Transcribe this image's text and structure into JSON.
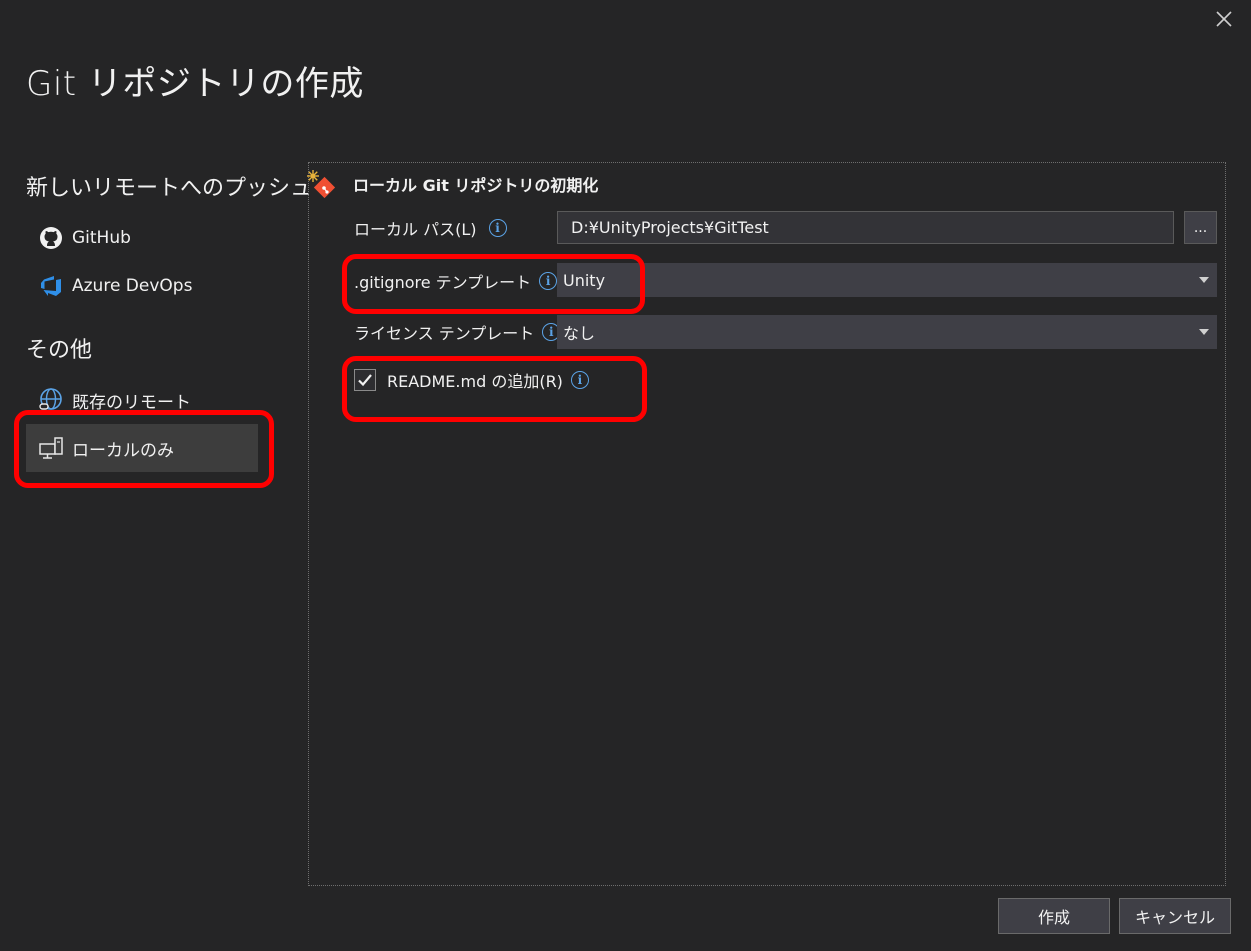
{
  "dialog": {
    "title": "Git リポジトリの作成"
  },
  "sidebar": {
    "push_section": "新しいリモートへのプッシュ",
    "other_section": "その他",
    "items": [
      {
        "label": "GitHub",
        "icon": "github-icon"
      },
      {
        "label": "Azure DevOps",
        "icon": "azure-devops-icon"
      },
      {
        "label": "既存のリモート",
        "icon": "globe-link-icon"
      },
      {
        "label": "ローカルのみ",
        "icon": "local-computer-icon",
        "selected": true
      }
    ]
  },
  "panel": {
    "header": "ローカル Git リポジトリの初期化",
    "local_path_label": "ローカル パス(L)",
    "local_path_value": "D:¥UnityProjects¥GitTest",
    "browse_label": "...",
    "gitignore_label": ".gitignore テンプレート",
    "gitignore_value": "Unity",
    "license_label": "ライセンス テンプレート",
    "license_value": "なし",
    "readme_label": "README.md の追加(R)",
    "readme_checked": true,
    "info_glyph": "i"
  },
  "footer": {
    "create_label": "作成",
    "cancel_label": "キャンセル"
  },
  "colors": {
    "background": "#252526",
    "highlight": "#ff0000",
    "info": "#5ba3e6",
    "git_brand": "#f05033"
  }
}
